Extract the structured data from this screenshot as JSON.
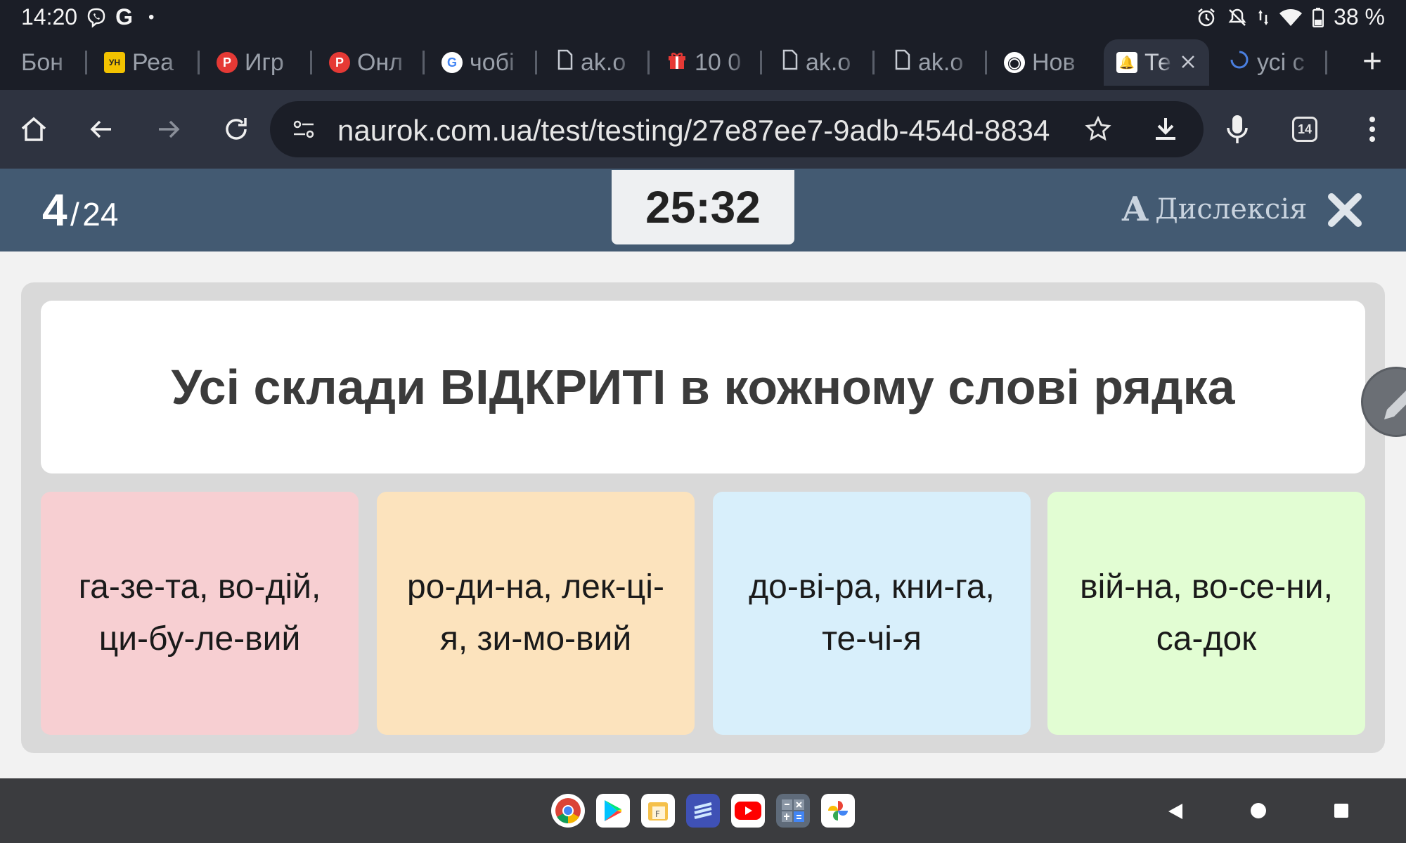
{
  "status_bar": {
    "time": "14:20",
    "google_glyph": "G",
    "dot": "•",
    "battery": "38 %"
  },
  "tabs": [
    {
      "label": "Бон",
      "fav_color": "#2e3340",
      "fav_text": ""
    },
    {
      "label": "Реа",
      "fav_color": "#f2c200",
      "fav_text": "УН"
    },
    {
      "label": "Игр",
      "fav_color": "#e53935",
      "fav_text": "P"
    },
    {
      "label": "Онл",
      "fav_color": "#e53935",
      "fav_text": "P"
    },
    {
      "label": "чобі",
      "fav_color": "#ffffff",
      "fav_text": "G"
    },
    {
      "label": "ak.o",
      "fav_color": "",
      "fav_text": ""
    },
    {
      "label": "10 0",
      "fav_color": "#e53935",
      "fav_text": "🎁"
    },
    {
      "label": "ak.o",
      "fav_color": "",
      "fav_text": ""
    },
    {
      "label": "ak.o",
      "fav_color": "",
      "fav_text": ""
    },
    {
      "label": "Нов",
      "fav_color": "#ffffff",
      "fav_text": "◉"
    },
    {
      "label": "Те",
      "fav_color": "#f5a623",
      "fav_text": "🔔",
      "active": true
    },
    {
      "label": "усі с",
      "fav_color": "",
      "fav_text": ""
    }
  ],
  "toolbar": {
    "url": "naurok.com.ua/test/testing/27e87ee7-9adb-454d-8834",
    "tab_count": "14"
  },
  "quiz": {
    "current": "4",
    "separator": "/",
    "total": "24",
    "timer": "25:32",
    "dyslexia_icon": "A",
    "dyslexia_label": "Дислексія",
    "question": "Усі склади ВІДКРИТІ в кожному слові рядка",
    "options": [
      {
        "text": "га-зе-та, во-дій, ци-бу-ле-вий",
        "color": "#f7cfd2"
      },
      {
        "text": "ро-ди-на, лек-ці-я, зи-мо-вий",
        "color": "#fce3bd"
      },
      {
        "text": "до-ві-ра, кни-га, те-чі-я",
        "color": "#d8effb"
      },
      {
        "text": "вій-на, во-се-ни, са-док",
        "color": "#e2fdd3"
      }
    ]
  },
  "dock": {
    "apps": [
      "chrome-icon",
      "play-store-icon",
      "files-icon",
      "stack-icon",
      "youtube-icon",
      "calculator-icon",
      "photos-icon"
    ]
  },
  "colors": {
    "header": "#435a72",
    "browser_dark": "#1b1e27",
    "toolbar": "#2e3340"
  }
}
